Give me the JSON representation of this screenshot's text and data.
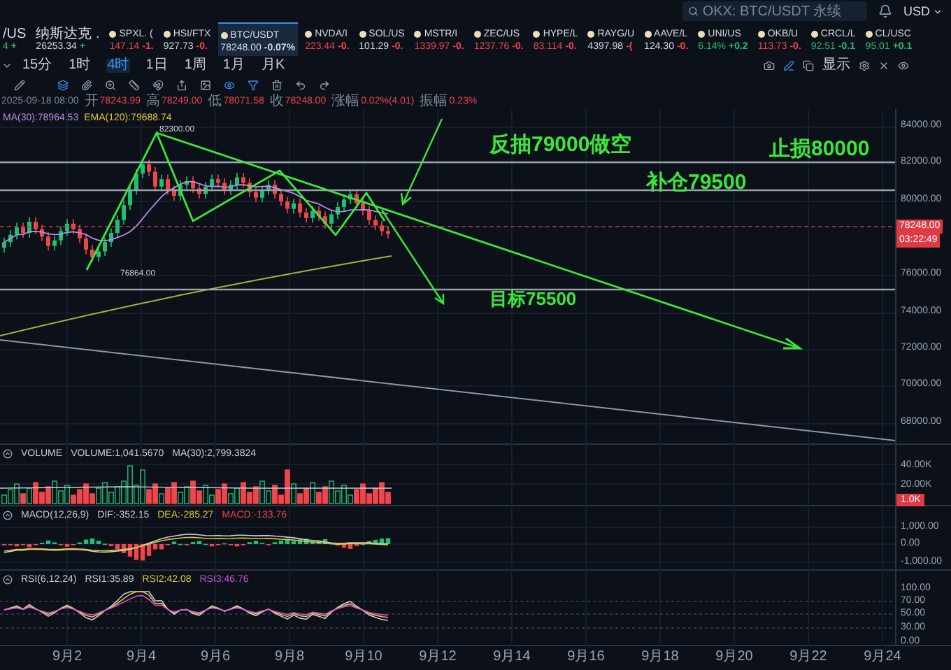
{
  "top_bar": {
    "search": {
      "placeholder": "OKX: BTC/USDT 永续"
    },
    "currency": "USD"
  },
  "tickers": [
    {
      "symbol": "/US",
      "price": {
        "text": "4",
        "color": "#1fbf75"
      },
      "change": {
        "text": "+",
        "color": "#1fbf75"
      },
      "icon": false,
      "selected": false
    },
    {
      "symbol": "纳斯达克 .",
      "price": {
        "text": "26253.34",
        "color": "#d5d9e0"
      },
      "change": {
        "text": "+",
        "color": "#1fbf75"
      },
      "icon": false,
      "selected": false
    },
    {
      "symbol": "SPXL. (",
      "price": {
        "text": "147.14",
        "color": "#f0454a"
      },
      "change": {
        "text": "-1.",
        "color": "#f0454a"
      },
      "icon": true,
      "selected": false
    },
    {
      "symbol": "HSI/FTX",
      "price": {
        "text": "927.73",
        "color": "#d5d9e0"
      },
      "change": {
        "text": "-0.",
        "color": "#f0454a"
      },
      "icon": true,
      "selected": false
    },
    {
      "symbol": "BTC/USDT",
      "price": {
        "text": "78248.00",
        "color": "#d5d9e0"
      },
      "change": {
        "text": "-0.07%",
        "color": "#d5d9e0"
      },
      "icon": true,
      "selected": true
    },
    {
      "symbol": "NVDA/I",
      "price": {
        "text": "223.44",
        "color": "#f0454a"
      },
      "change": {
        "text": "-0.",
        "color": "#f0454a"
      },
      "icon": true,
      "selected": false
    },
    {
      "symbol": "SOL/US",
      "price": {
        "text": "101.29",
        "color": "#d5d9e0"
      },
      "change": {
        "text": "-0.",
        "color": "#f0454a"
      },
      "icon": true,
      "selected": false
    },
    {
      "symbol": "MSTR/I",
      "price": {
        "text": "1339.97",
        "color": "#f0454a"
      },
      "change": {
        "text": "-0.",
        "color": "#f0454a"
      },
      "icon": true,
      "selected": false
    },
    {
      "symbol": "ZEC/US",
      "price": {
        "text": "1237.76",
        "color": "#f0454a"
      },
      "change": {
        "text": "-0.",
        "color": "#f0454a"
      },
      "icon": true,
      "selected": false
    },
    {
      "symbol": "HYPE/L",
      "price": {
        "text": "83.114",
        "color": "#f0454a"
      },
      "change": {
        "text": "-0.",
        "color": "#f0454a"
      },
      "icon": true,
      "selected": false
    },
    {
      "symbol": "RAYG/U",
      "price": {
        "text": "4397.98",
        "color": "#d5d9e0"
      },
      "change": {
        "text": "-(",
        "color": "#f0454a"
      },
      "icon": true,
      "selected": false
    },
    {
      "symbol": "AAVE/L",
      "price": {
        "text": "124.30",
        "color": "#d5d9e0"
      },
      "change": {
        "text": "-0.",
        "color": "#f0454a"
      },
      "icon": true,
      "selected": false
    },
    {
      "symbol": "UNI/US",
      "price": {
        "text": "6.14%",
        "color": "#1fbf75"
      },
      "change": {
        "text": "+0.2",
        "color": "#1fbf75"
      },
      "icon": true,
      "selected": false
    },
    {
      "symbol": "OKB/U",
      "price": {
        "text": "113.73",
        "color": "#f0454a"
      },
      "change": {
        "text": "-0.",
        "color": "#f0454a"
      },
      "icon": true,
      "selected": false
    },
    {
      "symbol": "CRCL/L",
      "price": {
        "text": "92.51",
        "color": "#1fbf75"
      },
      "change": {
        "text": "-0.1",
        "color": "#1fbf75"
      },
      "icon": true,
      "selected": false
    },
    {
      "symbol": "CL/USC",
      "price": {
        "text": "95.01",
        "color": "#1fbf75"
      },
      "change": {
        "text": "+0.1",
        "color": "#1fbf75"
      },
      "icon": true,
      "selected": false
    }
  ],
  "timeframes": [
    {
      "label": "15分",
      "selected": false
    },
    {
      "label": "1时",
      "selected": false
    },
    {
      "label": "4时",
      "selected": true
    },
    {
      "label": "1日",
      "selected": false
    },
    {
      "label": "1周",
      "selected": false
    },
    {
      "label": "1月",
      "selected": false
    },
    {
      "label": "月K",
      "selected": false
    }
  ],
  "chart_toolbar": {
    "display_label": "显示"
  },
  "ohlc": {
    "time": "2025-09-18 08:00",
    "fields": [
      {
        "label": "开",
        "value": "78243.99"
      },
      {
        "label": "高",
        "value": "78249.00"
      },
      {
        "label": "低",
        "value": "78071.58"
      },
      {
        "label": "收",
        "value": "78248.00"
      },
      {
        "label": "涨幅",
        "value": "0.02%(4.01)"
      },
      {
        "label": "振幅",
        "value": "0.23%"
      }
    ]
  },
  "price_chart": {
    "indicators": [
      {
        "text": "MA(30):78964.53",
        "color": "#b98be0"
      },
      {
        "text": "EMA(120):79688.74",
        "color": "#e3c43b"
      }
    ],
    "high_label": "82300.00",
    "low_label": "76864.00",
    "annotations": [
      {
        "text": "反抽79000做空"
      },
      {
        "text": "止损80000"
      },
      {
        "text": "补仓79500"
      },
      {
        "text": "目标75500"
      }
    ],
    "last_price": "78248.00",
    "countdown": "03:22:49",
    "y_axis": [
      "84000.00",
      "82000.00",
      "80000.00",
      "76000.00",
      "74000.00",
      "72000.00",
      "70000.00",
      "68000.00"
    ]
  },
  "volume_panel": {
    "title": "VOLUME",
    "readings": [
      {
        "text": "VOLUME:1,041.5670",
        "color": "#c8ccd4"
      },
      {
        "text": "MA(30):2,799.3824",
        "color": "#c8ccd4"
      }
    ],
    "y_axis": [
      "40.00K",
      "20.00K"
    ],
    "last_tag": "1.0K"
  },
  "macd_panel": {
    "title": "MACD(12,26,9)",
    "readings": [
      {
        "text": "DIF:-352.15",
        "color": "#c8ccd4"
      },
      {
        "text": "DEA:-285.27",
        "color": "#e3c43b"
      },
      {
        "text": "MACD:-133.76",
        "color": "#f0454a"
      }
    ],
    "y_axis": [
      "1,000.00",
      "0.00",
      "-1,000.00"
    ]
  },
  "rsi_panel": {
    "title": "RSI(6,12,24)",
    "readings": [
      {
        "text": "RSI1:35.89",
        "color": "#c8ccd4"
      },
      {
        "text": "RSI2:42.08",
        "color": "#e3c43b"
      },
      {
        "text": "RSI3:46.76",
        "color": "#d44fd4"
      }
    ],
    "y_axis": [
      "100.00",
      "70.00",
      "50.00",
      "30.00",
      "0.00"
    ]
  },
  "x_axis": [
    "9月2",
    "9月4",
    "9月6",
    "9月8",
    "9月10",
    "9月12",
    "9月14",
    "9月16",
    "9月18",
    "9月20",
    "9月22",
    "9月24"
  ]
}
